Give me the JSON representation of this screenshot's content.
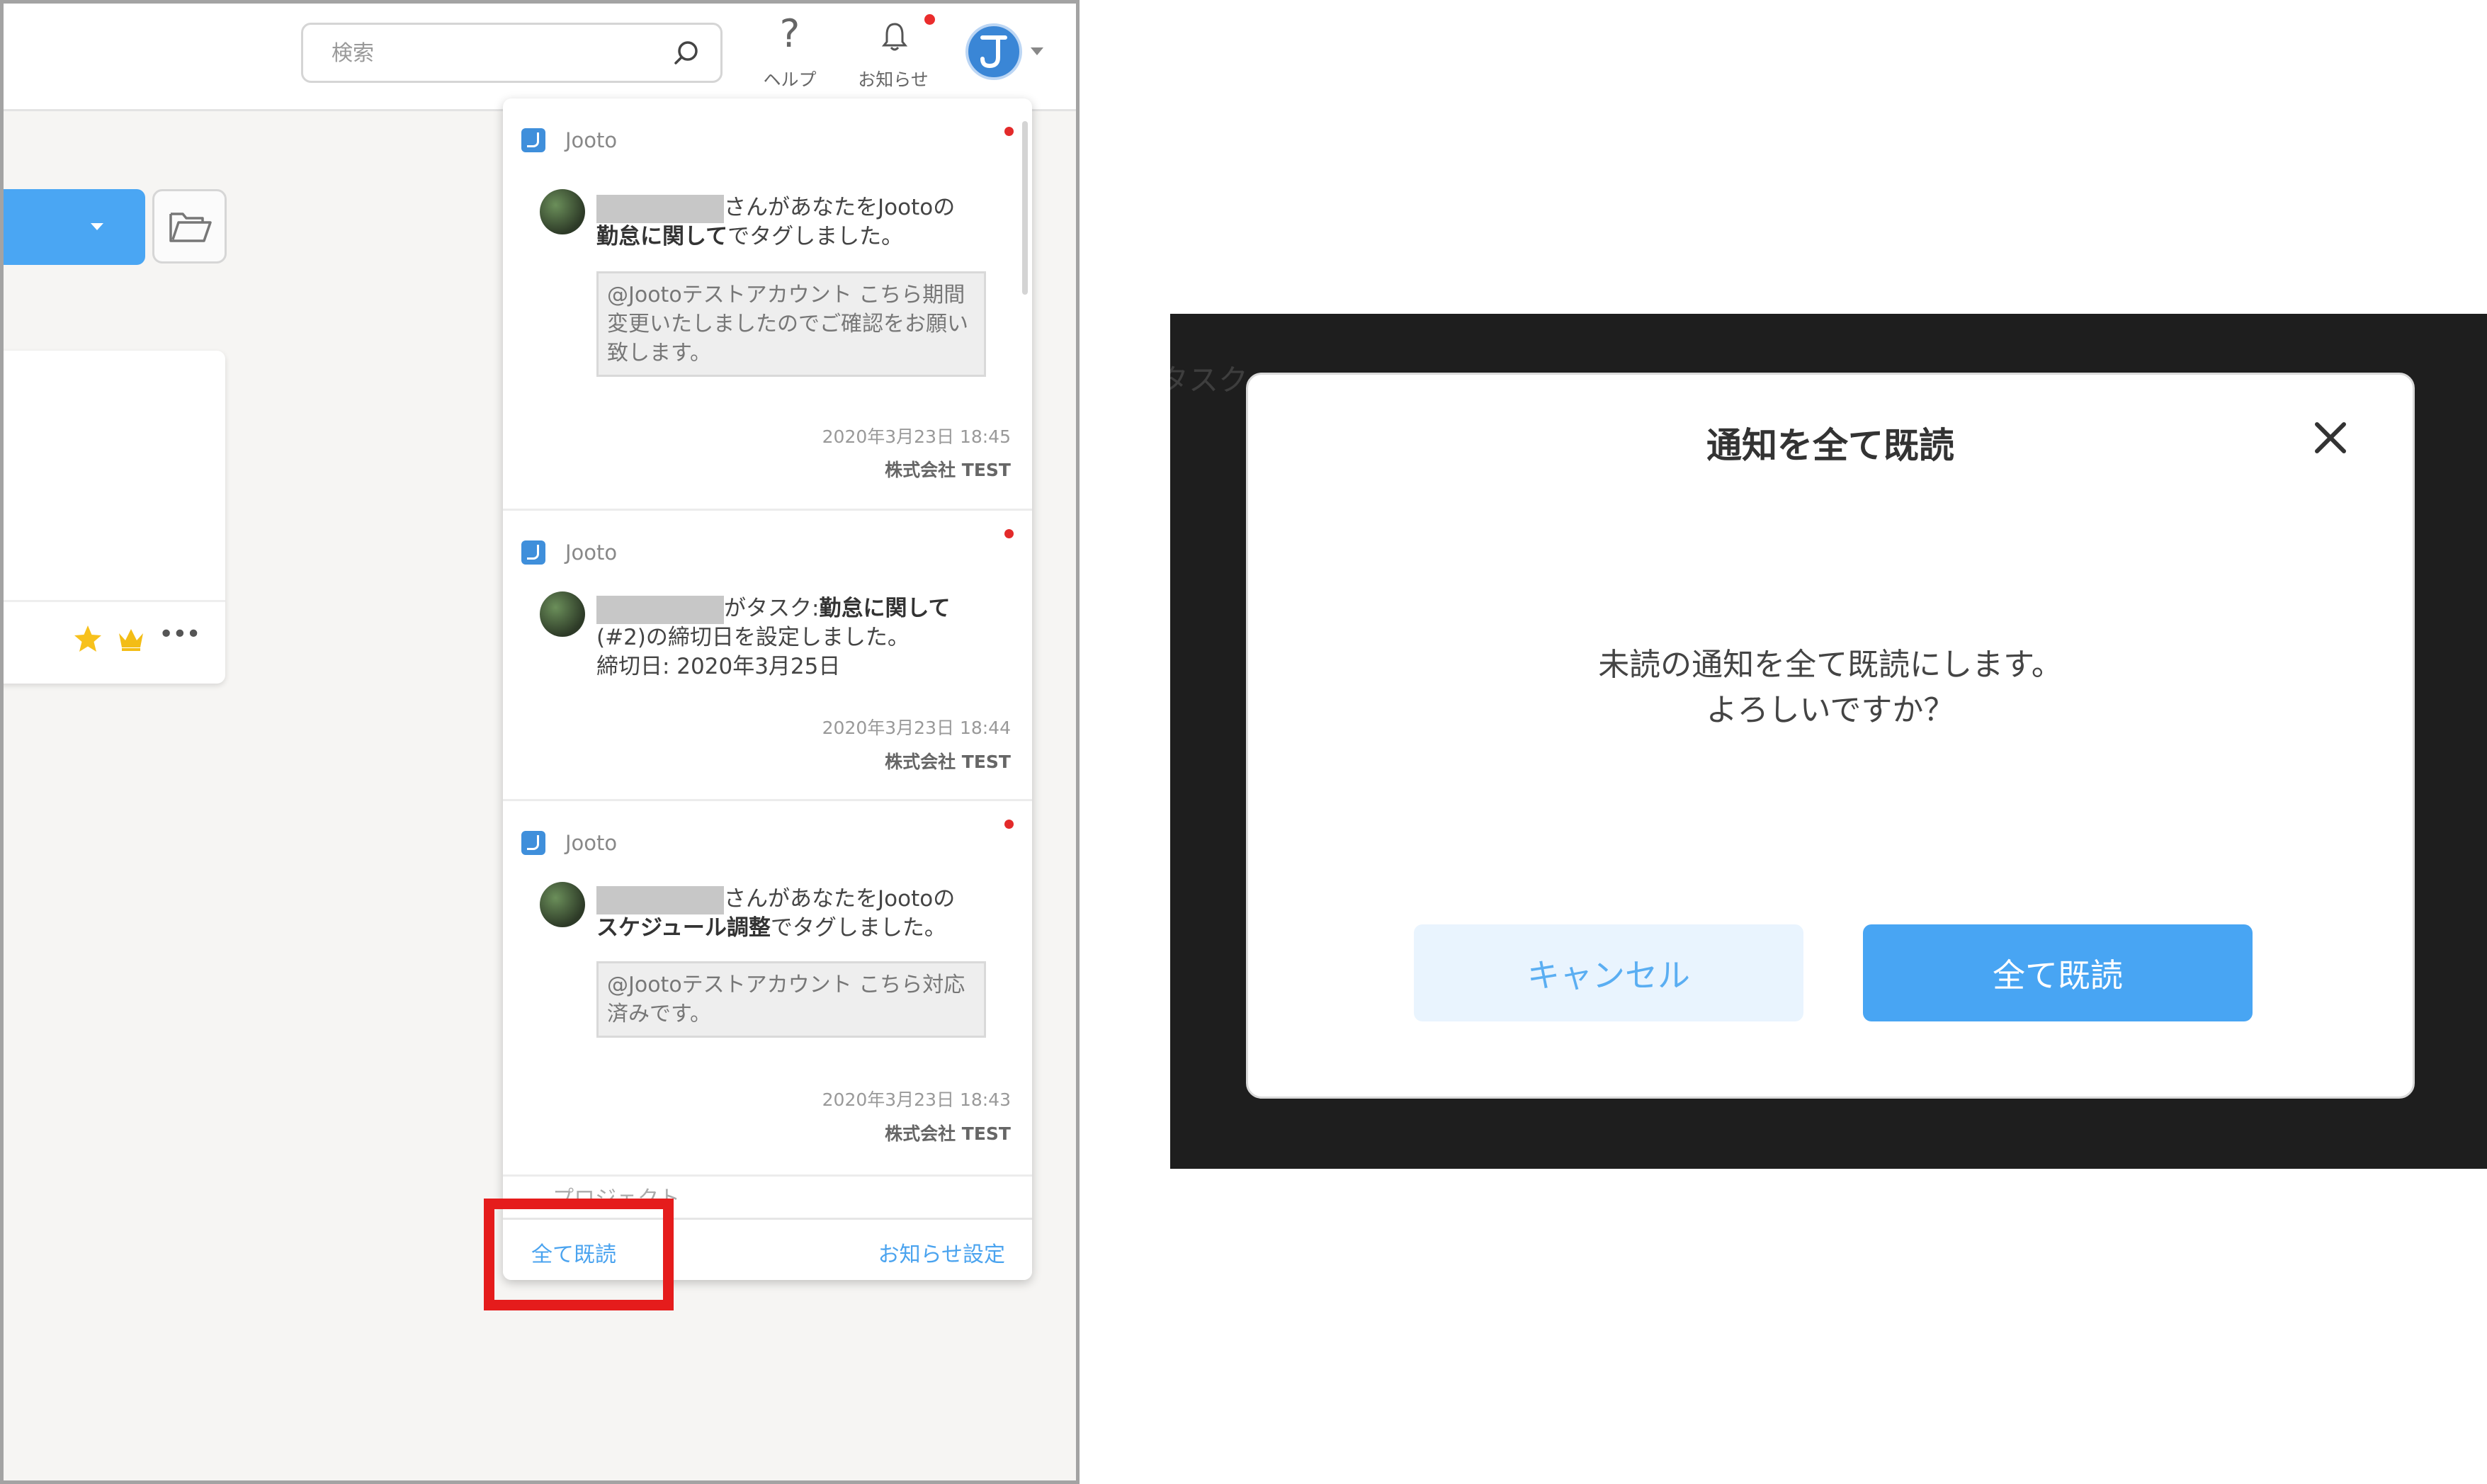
{
  "header": {
    "search_placeholder": "検索",
    "help_label": "ヘルプ",
    "help_glyph": "?",
    "notice_label": "お知らせ",
    "avatar_initial": "J"
  },
  "notifications": {
    "items": [
      {
        "source": "Jooto",
        "body_rest": "さんがあなたをJootoの",
        "body_bold": "勤怠に関して",
        "body_tail": "でタグしました。",
        "quote": "@Jootoテストアカウント こちら期間変更いたしましたのでご確認をお願い致します。",
        "time": "2020年3月23日 18:45",
        "company": "株式会社 TEST",
        "unread": true
      },
      {
        "source": "Jooto",
        "body_rest": "がタスク:",
        "body_bold": "勤怠に関して",
        "body_tail": "(#2)の締切日を設定しました。",
        "body_line3": "締切日: 2020年3月25日",
        "time": "2020年3月23日 18:44",
        "company": "株式会社 TEST",
        "unread": true
      },
      {
        "source": "Jooto",
        "body_rest": "さんがあなたをJootoの",
        "body_bold": "スケジュール調整",
        "body_tail": "でタグしました。",
        "quote": "@Jootoテストアカウント こちら対応済みです。",
        "time": "2020年3月23日 18:43",
        "company": "株式会社 TEST",
        "unread": true
      }
    ],
    "partial_next": "プロジェクト",
    "footer": {
      "mark_all": "全て既読",
      "settings": "お知らせ設定"
    }
  },
  "background": {
    "ghost_text": "タスク"
  },
  "dialog": {
    "title": "通知を全て既読",
    "message_line1": "未読の通知を全て既読にします。",
    "message_line2": "よろしいですか？",
    "cancel_label": "キャンセル",
    "confirm_label": "全て既読"
  },
  "colors": {
    "accent": "#48a5f3",
    "highlight": "#e51c1c",
    "unread_dot": "#e32a2a"
  }
}
